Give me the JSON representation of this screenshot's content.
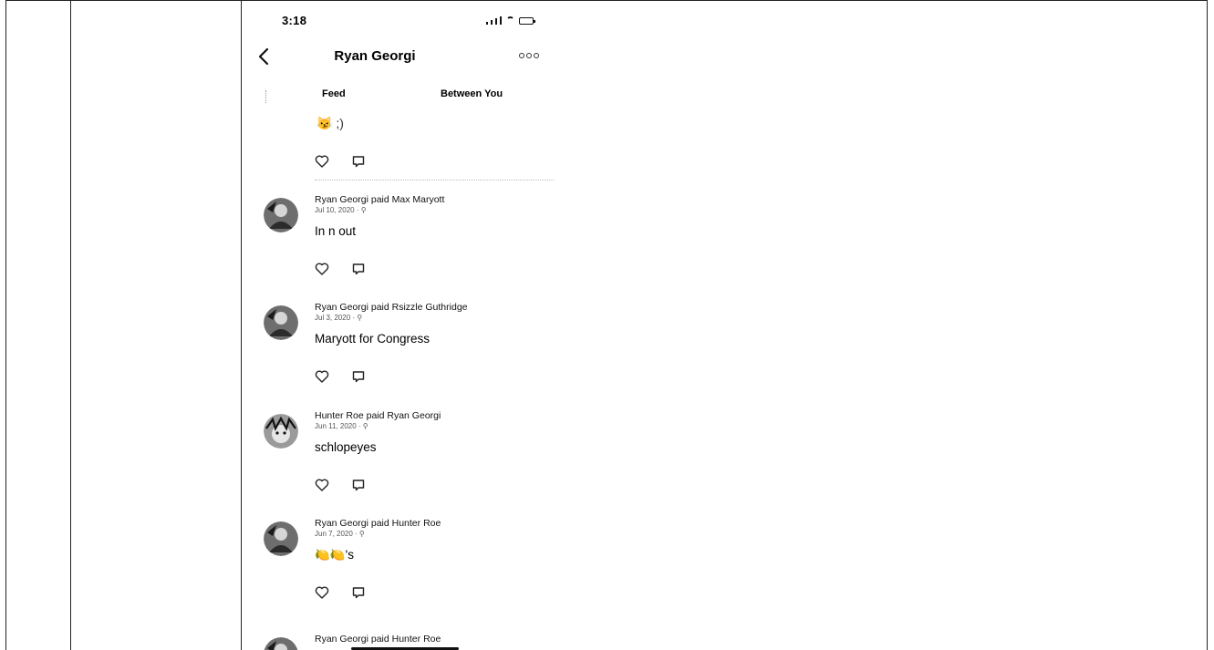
{
  "status_bar": {
    "time": "3:18"
  },
  "nav": {
    "title": "Ryan Georgi",
    "back_icon": "chevron-left-icon",
    "more_icon": "ellipsis-icon"
  },
  "tabs": [
    {
      "label": "Feed"
    },
    {
      "label": "Between You"
    }
  ],
  "partial_top_note": "😼 ;)",
  "feed": [
    {
      "header": "Ryan Georgi paid Max Maryott",
      "date": "Jul 10, 2020 · ⚲",
      "note": "In n out"
    },
    {
      "header": "Ryan Georgi paid Rsizzle Guthridge",
      "date": "Jul 3, 2020 · ⚲",
      "note": "Maryott for Congress"
    },
    {
      "header": "Hunter Roe paid Ryan Georgi",
      "date": "Jun 11, 2020 · ⚲",
      "note": "schlopeyes"
    },
    {
      "header": "Ryan Georgi paid Hunter Roe",
      "date": "Jun 7, 2020 · ⚲",
      "note": "🍋🍋's"
    },
    {
      "header": "Ryan Georgi paid Hunter Roe",
      "date": "",
      "note": ""
    }
  ],
  "icons": {
    "like": "heart-icon",
    "comment": "comment-icon"
  }
}
